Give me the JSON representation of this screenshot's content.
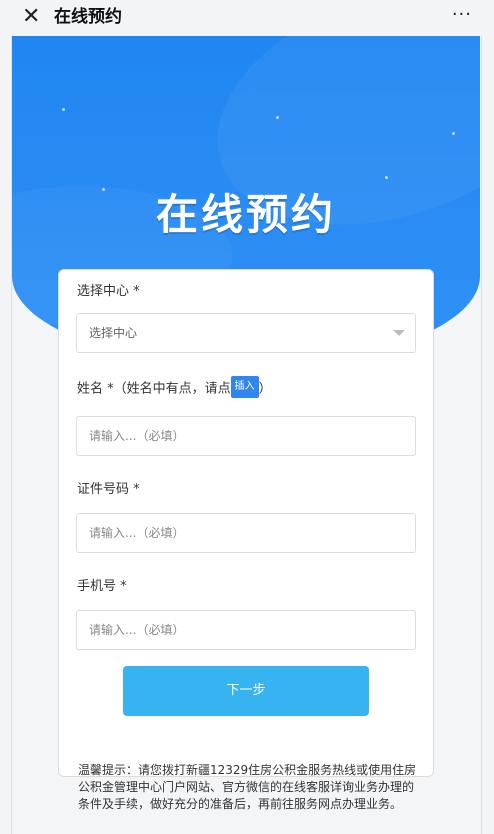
{
  "header": {
    "title": "在线预约",
    "close_icon": "close-icon",
    "more_icon": "more-icon",
    "more_glyph": "···"
  },
  "hero": {
    "title": "在线预约"
  },
  "form": {
    "center": {
      "label": "选择中心 *",
      "value": "选择中心"
    },
    "name": {
      "label_prefix": "姓名 *（姓名中有点，请点",
      "insert_label": "插入",
      "label_suffix": "）",
      "placeholder": "请输入...（必填）"
    },
    "id_number": {
      "label": "证件号码 *",
      "placeholder": "请输入...（必填）"
    },
    "phone": {
      "label": "手机号 *",
      "placeholder": "请输入...（必填）"
    },
    "next_label": "下一步"
  },
  "tips": "温馨提示：请您拨打新疆12329住房公积金服务热线或使用住房公积金管理中心门户网站、官方微信的在线客服详询业务办理的条件及手续，做好充分的准备后，再前往服务网点办理业务。",
  "colors": {
    "primary": "#2a8cf4",
    "button": "#36b3f0",
    "insert": "#2f86ee"
  }
}
